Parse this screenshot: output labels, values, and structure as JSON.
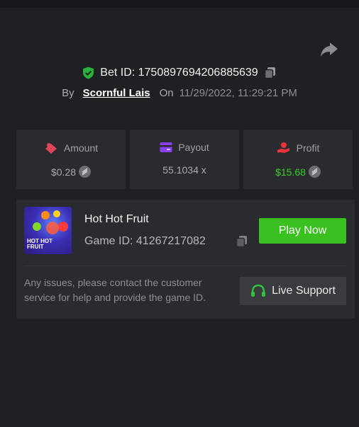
{
  "header": {
    "bet_label": "Bet ID: 1750897694206885639",
    "by": "By",
    "user": "Scornful Lais",
    "on": "On",
    "date": "11/29/2022, 11:29:21 PM"
  },
  "stats": {
    "amount": {
      "label": "Amount",
      "value": "$0.28"
    },
    "payout": {
      "label": "Payout",
      "value": "55.1034 x"
    },
    "profit": {
      "label": "Profit",
      "value": "$15.68"
    }
  },
  "game": {
    "title": "Hot Hot Fruit",
    "id": "Game ID: 41267217082",
    "thumb_text": "HOT HOT FRUIT",
    "play_label": "Play Now",
    "issue_text": "Any issues, please contact the customer service for help and provide the game ID.",
    "support_label": "Live Support"
  },
  "colors": {
    "green": "#3bc11f",
    "profit_green": "#3bcc2d",
    "amount_icon": "#e0455c",
    "payout_icon": "#8b3ff2",
    "profit_icon": "#e8333b"
  },
  "icons": [
    "share-icon",
    "shield-check-icon",
    "copy-icon",
    "amount-icon",
    "payout-card-icon",
    "profit-hand-icon",
    "coin-icon",
    "headset-icon"
  ]
}
